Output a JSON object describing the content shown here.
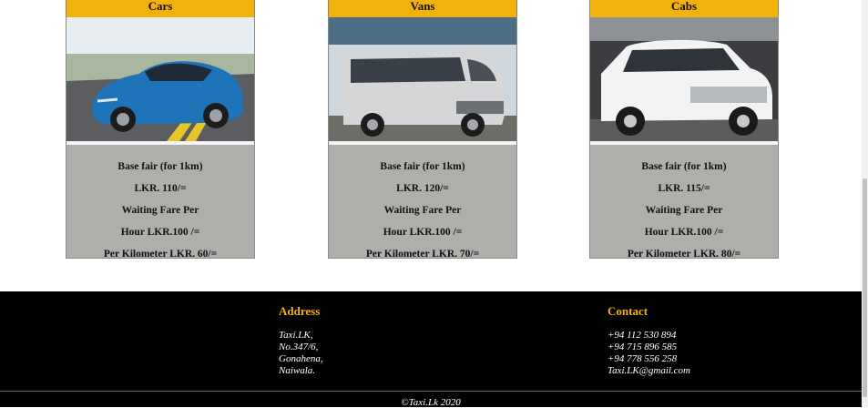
{
  "cards": [
    {
      "title": "Cars",
      "image": "blue-sedan-photo",
      "lines": [
        "Base fair (for 1km)",
        "LKR. 110/=",
        "Waiting Fare Per",
        "Hour LKR.100 /=",
        "Per Kilometer LKR. 60/="
      ]
    },
    {
      "title": "Vans",
      "image": "silver-van-photo",
      "lines": [
        "Base fair (for 1km)",
        "LKR. 120/=",
        "Waiting Fare Per",
        "Hour LKR.100 /=",
        "Per Kilometer LKR. 70/="
      ]
    },
    {
      "title": "Cabs",
      "image": "white-pickup-photo",
      "lines": [
        "Base fair (for 1km)",
        "LKR. 115/=",
        "Waiting Fare Per",
        "Hour LKR.100 /=",
        "Per Kilometer LKR. 80/="
      ]
    }
  ],
  "footer": {
    "address_heading": "Address",
    "address_lines": [
      "Taxi.LK,",
      "No.347/6,",
      "Gonahena,",
      "Naiwala."
    ],
    "contact_heading": "Contact",
    "contact_lines": [
      "+94 112 530 894",
      "+94 715 896 585",
      "+94 778 556 258",
      "Taxi.LK@gmail.com"
    ],
    "copyright": "©Taxi.Lk 2020"
  },
  "colors": {
    "accent": "#f2b20a",
    "card_body": "#b0aeab",
    "footer_bg": "#000000"
  }
}
